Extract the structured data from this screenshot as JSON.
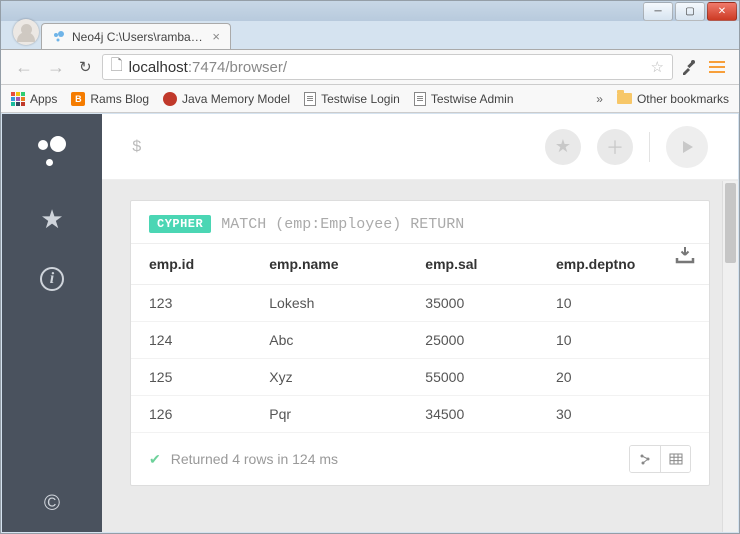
{
  "window": {
    "tab_title": "Neo4j C:\\Users\\rambabu.p",
    "url_host": "localhost",
    "url_port_path": ":7474/browser/"
  },
  "bookmarks": {
    "apps": "Apps",
    "items": [
      "Rams Blog",
      "Java Memory Model",
      "Testwise Login",
      "Testwise Admin"
    ],
    "more": "»",
    "other": "Other bookmarks"
  },
  "editor": {
    "prompt": "$"
  },
  "result": {
    "badge": "CYPHER",
    "query": "MATCH (emp:Employee) RETURN",
    "columns": [
      "emp.id",
      "emp.name",
      "emp.sal",
      "emp.deptno"
    ],
    "rows": [
      {
        "id": "123",
        "name": "Lokesh",
        "sal": "35000",
        "deptno": "10"
      },
      {
        "id": "124",
        "name": "Abc",
        "sal": "25000",
        "deptno": "10"
      },
      {
        "id": "125",
        "name": "Xyz",
        "sal": "55000",
        "deptno": "20"
      },
      {
        "id": "126",
        "name": "Pqr",
        "sal": "34500",
        "deptno": "30"
      }
    ],
    "status": "Returned 4 rows in 124 ms"
  }
}
